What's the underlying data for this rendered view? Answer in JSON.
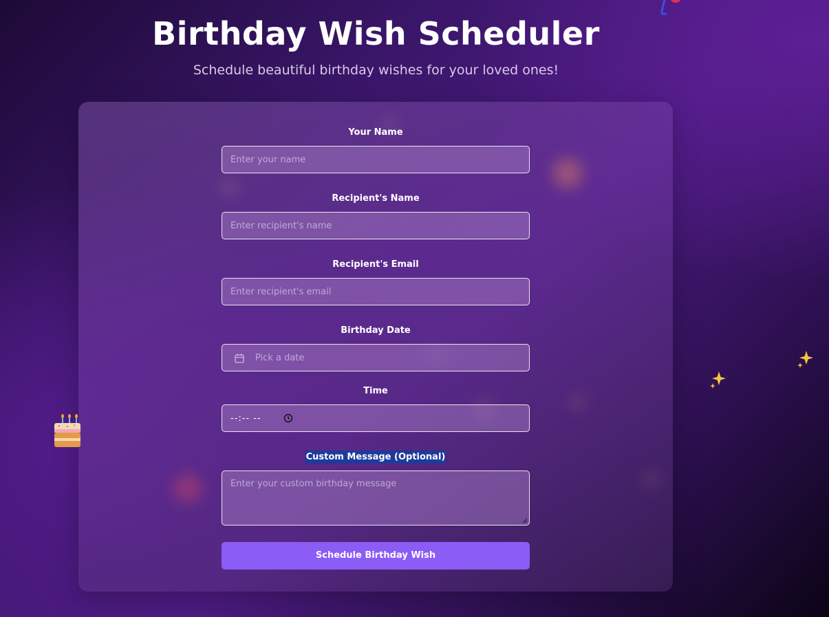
{
  "header": {
    "title": "Birthday Wish Scheduler",
    "subtitle": "Schedule beautiful birthday wishes for your loved ones!"
  },
  "form": {
    "your_name": {
      "label": "Your Name",
      "placeholder": "Enter your name",
      "value": ""
    },
    "recipient_name": {
      "label": "Recipient's Name",
      "placeholder": "Enter recipient's name",
      "value": ""
    },
    "recipient_email": {
      "label": "Recipient's Email",
      "placeholder": "Enter recipient's email",
      "value": ""
    },
    "birthday_date": {
      "label": "Birthday Date",
      "placeholder": "Pick a date",
      "icon": "calendar-icon"
    },
    "time": {
      "label": "Time",
      "value": "--:-- --",
      "icon": "clock-icon"
    },
    "custom_message": {
      "label": "Custom Message (Optional)",
      "placeholder": "Enter your custom birthday message",
      "value": ""
    },
    "submit_label": "Schedule Birthday Wish"
  },
  "decorations": [
    "cake-emoji",
    "sparkle-emoji",
    "sparkle-emoji",
    "balloon-emoji"
  ],
  "colors": {
    "accent": "#8b5cf6",
    "label_highlight": "#1e3a9a",
    "background_dark": "#1d0a36",
    "background_purple": "#5d1f95"
  }
}
